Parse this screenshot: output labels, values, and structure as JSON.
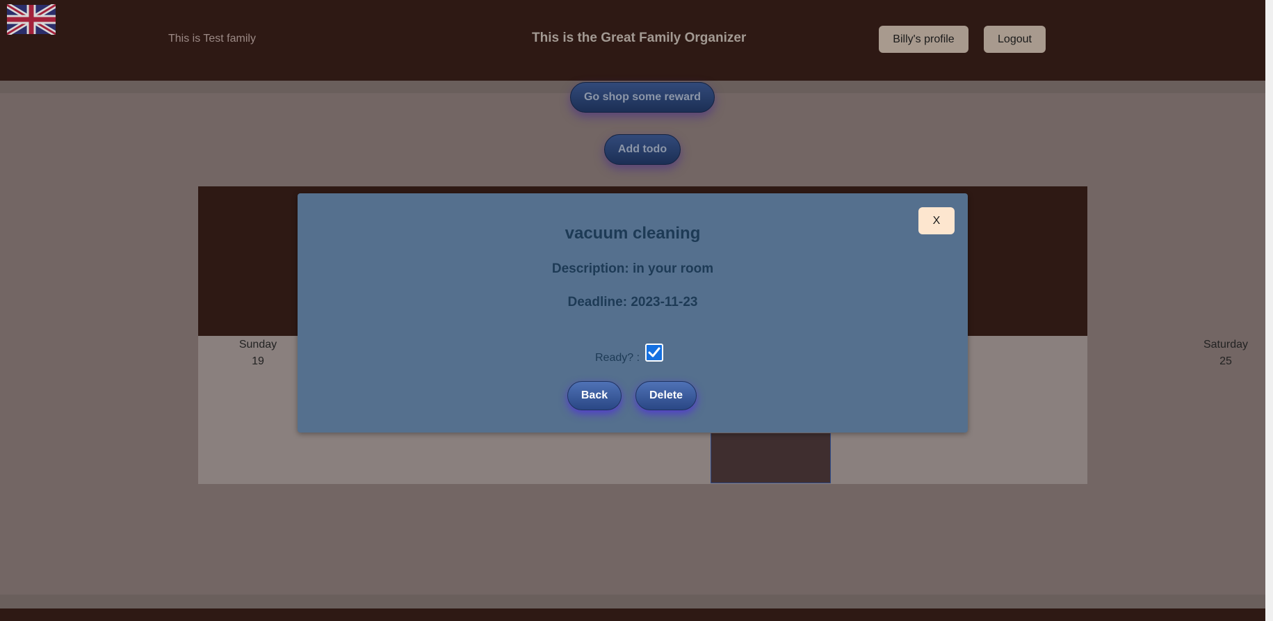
{
  "header": {
    "family_name": "This is Test family",
    "app_title": "This is the Great Family Organizer",
    "profile_label": "Billy's profile",
    "logout_label": "Logout"
  },
  "actions": {
    "shop_label": "Go shop some reward",
    "add_todo_label": "Add todo"
  },
  "calendar": {
    "days": [
      {
        "name": "Sunday",
        "date": "19"
      },
      {
        "name": "Saturday",
        "date": "25"
      }
    ]
  },
  "modal": {
    "close_label": "X",
    "title": "vacuum cleaning",
    "description": "Description: in your room",
    "deadline": "Deadline: 2023-11-23",
    "ready_label": "Ready? :",
    "ready_checked": true,
    "back_label": "Back",
    "delete_label": "Delete"
  },
  "colors": {
    "header_bg": "#2e1914",
    "modal_bg": "#55708e",
    "pill_blue": "#2a4785"
  },
  "icons": {
    "flag": "uk-flag-icon",
    "check": "checkmark-icon"
  }
}
